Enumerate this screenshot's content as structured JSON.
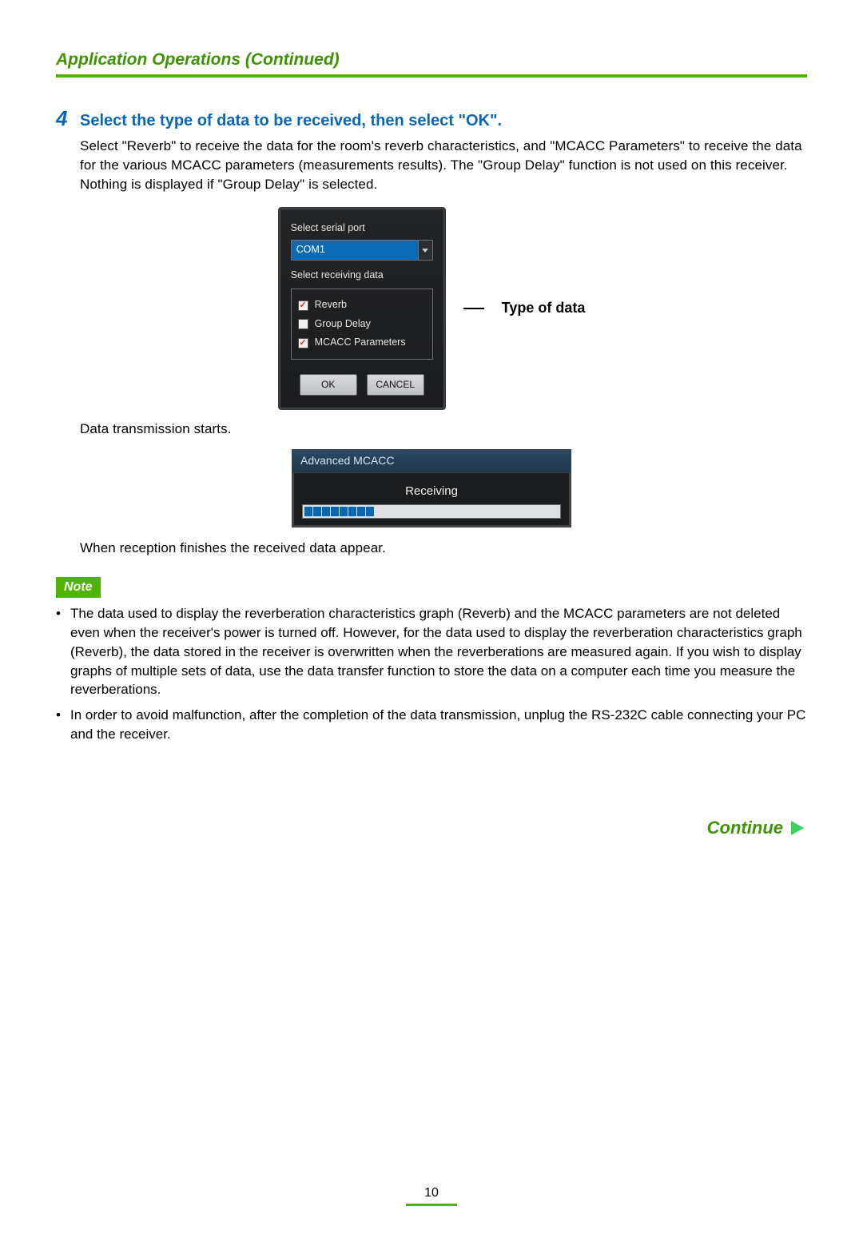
{
  "header": {
    "section_title": "Application Operations (Continued)"
  },
  "step": {
    "number": "4",
    "title": "Select the type of data to be received, then select \"OK\".",
    "intro": "Select \"Reverb\" to receive the data for the room's reverb characteristics, and \"MCACC Parameters\" to receive the data for the various MCACC parameters (measurements results). The \"Group Delay\" function is not used on this receiver. Nothing is displayed if \"Group Delay\" is selected."
  },
  "dialog1": {
    "label_port": "Select serial port",
    "port_value": "COM1",
    "label_receiving": "Select receiving data",
    "options": {
      "reverb": "Reverb",
      "group_delay": "Group Delay",
      "mcacc": "MCACC Parameters"
    },
    "ok": "OK",
    "cancel": "CANCEL"
  },
  "callout": {
    "type_of_data": "Type of data"
  },
  "post_dialog1_text": "Data transmission starts.",
  "dialog2": {
    "title": "Advanced MCACC",
    "receiving_label": "Receiving"
  },
  "post_dialog2_text": "When reception finishes the received data appear.",
  "note": {
    "label": "Note",
    "bullets": [
      "The data used to display the reverberation characteristics graph (Reverb) and the MCACC parameters are not deleted even when the receiver's power is turned off. However, for the data used to display the reverberation characteristics graph (Reverb), the data stored in the receiver is overwritten when the reverberations are measured again. If you wish to display graphs of multiple sets of data, use the data transfer function to store the data on a computer each time you measure the reverberations.",
      "In order to avoid malfunction, after the completion of the data transmission, unplug the RS-232C cable connecting your PC and the receiver."
    ]
  },
  "continue_label": "Continue",
  "page_number": "10"
}
